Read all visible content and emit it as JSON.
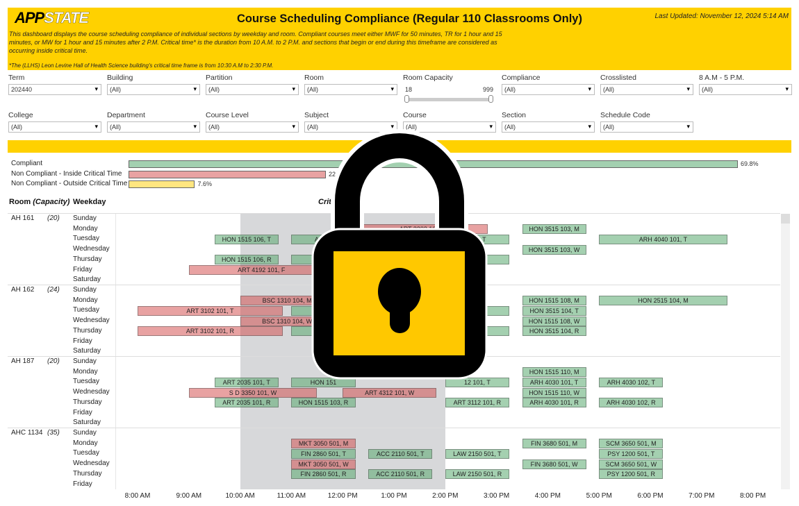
{
  "header": {
    "logo_text": "APPSTATE",
    "title": "Course Scheduling Compliance (Regular 110 Classrooms Only)",
    "last_updated": "Last Updated: November 12, 2024 5:14 AM",
    "description": "This dashboard displays the course scheduling compliance of individual sections by weekday and room. Compliant courses meet either MWF for 50 minutes, TR for 1 hour and 15 minutes, or MW for 1 hour and 15 minutes after 2 P.M. Critical time* is the duration from 10 A.M. to 2 P.M. and sections that begin or end during this timeframe are considered as occurring inside critical time.",
    "note": "*The (LLHS) Leon Levine Hall of Health Science building's critical time frame is from 10:30 A.M to 2:30 P.M."
  },
  "filters": {
    "row1": [
      {
        "label": "Term",
        "value": "202440"
      },
      {
        "label": "Building",
        "value": "(All)"
      },
      {
        "label": "Partition",
        "value": "(All)"
      },
      {
        "label": "Room",
        "value": "(All)"
      },
      {
        "label": "Room Capacity",
        "min": "18",
        "max": "999"
      },
      {
        "label": "Compliance",
        "value": "(All)"
      },
      {
        "label": "Crosslisted",
        "value": "(All)"
      },
      {
        "label": "8 A.M - 5 P.M.",
        "value": "(All)"
      }
    ],
    "row2": [
      {
        "label": "College",
        "value": "(All)"
      },
      {
        "label": "Department",
        "value": "(All)"
      },
      {
        "label": "Course Level",
        "value": "(All)"
      },
      {
        "label": "Subject",
        "value": "(All)"
      },
      {
        "label": "Course",
        "value": "(All)"
      },
      {
        "label": "Section",
        "value": "(All)"
      },
      {
        "label": "Schedule Code",
        "value": "(All)"
      }
    ]
  },
  "summary": [
    {
      "label": "Compliant",
      "percent": 69.8,
      "pct_text": "69.8%",
      "color": "#a3d0b0"
    },
    {
      "label": "Non Compliant - Inside Critical Time",
      "percent": 22.6,
      "pct_text": "22",
      "color": "#e8a2a2"
    },
    {
      "label": "Non Compliant - Outside Critical Time",
      "percent": 7.6,
      "pct_text": "7.6%",
      "color": "#ffe680"
    }
  ],
  "table_header": {
    "room": "Room ",
    "capacity": "(Capacity)",
    "weekday": "Weekday",
    "critical": "Criti",
    "critical_end": "e"
  },
  "days": [
    "Sunday",
    "Monday",
    "Tuesday",
    "Wednesday",
    "Thursday",
    "Friday",
    "Saturday"
  ],
  "time_ticks": [
    "8:00 AM",
    "9:00 AM",
    "10:00 AM",
    "11:00 AM",
    "12:00 PM",
    "1:00 PM",
    "2:00 PM",
    "3:00 PM",
    "4:00 PM",
    "5:00 PM",
    "6:00 PM",
    "7:00 PM",
    "8:00 PM"
  ],
  "critical_time": [
    10,
    14
  ],
  "colors": {
    "compliant": "#a3d0b0",
    "non_compliant": "#e8a2a2",
    "brand": "#ffd100"
  },
  "rooms": [
    {
      "name": "AH 161",
      "capacity": "(20)",
      "sections": [
        {
          "label": "ART 3303 101, M",
          "day": 1,
          "start": 12.33,
          "end": 14.83,
          "ok": false
        },
        {
          "label": "HON 1515 106, T",
          "day": 2,
          "start": 9.5,
          "end": 10.75,
          "ok": true
        },
        {
          "label": "ART 2",
          "day": 2,
          "start": 11.0,
          "end": 12.25,
          "ok": true
        },
        {
          "label": "104, T",
          "day": 2,
          "start": 14.0,
          "end": 15.25,
          "ok": true
        },
        {
          "label": "HON 3515 103, M",
          "day": 1,
          "start": 15.5,
          "end": 16.75,
          "ok": true
        },
        {
          "label": "ARH 4040 101, T",
          "day": 2,
          "start": 17.0,
          "end": 19.5,
          "ok": true
        },
        {
          "label": "HON 3515 103, W",
          "day": 3,
          "start": 15.5,
          "end": 16.75,
          "ok": true
        },
        {
          "label": "HON 1515 106, R",
          "day": 4,
          "start": 9.5,
          "end": 10.75,
          "ok": true
        },
        {
          "label": "ART",
          "day": 4,
          "start": 11.0,
          "end": 12.25,
          "ok": true
        },
        {
          "label": "04, R",
          "day": 4,
          "start": 14.0,
          "end": 15.25,
          "ok": true
        },
        {
          "label": "ART 4192 101, F",
          "day": 5,
          "start": 9.0,
          "end": 11.83,
          "ok": false
        }
      ]
    },
    {
      "name": "AH 162",
      "capacity": "(24)",
      "sections": [
        {
          "label": "BSC 1310 104, M",
          "day": 1,
          "start": 10.0,
          "end": 11.83,
          "ok": false
        },
        {
          "label": "HON 1515 108, M",
          "day": 1,
          "start": 15.5,
          "end": 16.75,
          "ok": true
        },
        {
          "label": "HON 2515 104, M",
          "day": 1,
          "start": 17.0,
          "end": 19.5,
          "ok": true
        },
        {
          "label": "ART 3102 101, T",
          "day": 2,
          "start": 8.0,
          "end": 10.83,
          "ok": false
        },
        {
          "label": "HON",
          "day": 2,
          "start": 11.0,
          "end": 12.25,
          "ok": true
        },
        {
          "label": "03, T",
          "day": 2,
          "start": 14.0,
          "end": 15.25,
          "ok": true
        },
        {
          "label": "HON 3515 104, T",
          "day": 2,
          "start": 15.5,
          "end": 16.75,
          "ok": true
        },
        {
          "label": "BSC 1310 104, W",
          "day": 3,
          "start": 10.0,
          "end": 11.83,
          "ok": false
        },
        {
          "label": "HON 1515 108, W",
          "day": 3,
          "start": 15.5,
          "end": 16.75,
          "ok": true
        },
        {
          "label": "ART 3102 101, R",
          "day": 4,
          "start": 8.0,
          "end": 10.83,
          "ok": false
        },
        {
          "label": "HON",
          "day": 4,
          "start": 11.0,
          "end": 12.25,
          "ok": true
        },
        {
          "label": "03, R",
          "day": 4,
          "start": 14.0,
          "end": 15.25,
          "ok": true
        },
        {
          "label": "HON 3515 104, R",
          "day": 4,
          "start": 15.5,
          "end": 16.75,
          "ok": true
        }
      ]
    },
    {
      "name": "AH 187",
      "capacity": "(20)",
      "sections": [
        {
          "label": "HON 1515 110, M",
          "day": 1,
          "start": 15.5,
          "end": 16.75,
          "ok": true
        },
        {
          "label": "ART 2035 101, T",
          "day": 2,
          "start": 9.5,
          "end": 10.75,
          "ok": true
        },
        {
          "label": "HON 151",
          "day": 2,
          "start": 11.0,
          "end": 12.25,
          "ok": true
        },
        {
          "label": "12 101, T",
          "day": 2,
          "start": 14.0,
          "end": 15.25,
          "ok": true
        },
        {
          "label": "ARH 4030 101, T",
          "day": 2,
          "start": 15.5,
          "end": 16.75,
          "ok": true
        },
        {
          "label": "ARH 4030 102, T",
          "day": 2,
          "start": 17.0,
          "end": 18.25,
          "ok": true
        },
        {
          "label": "S D 3350 101, W",
          "day": 3,
          "start": 9.0,
          "end": 11.5,
          "ok": false
        },
        {
          "label": "ART 4312 101, W",
          "day": 3,
          "start": 12.0,
          "end": 13.83,
          "ok": false
        },
        {
          "label": "HON 1515 110, W",
          "day": 3,
          "start": 15.5,
          "end": 16.75,
          "ok": true
        },
        {
          "label": "ART 2035 101, R",
          "day": 4,
          "start": 9.5,
          "end": 10.75,
          "ok": true
        },
        {
          "label": "HON 1515 103, R",
          "day": 4,
          "start": 11.0,
          "end": 12.25,
          "ok": true
        },
        {
          "label": "ART 3112 101, R",
          "day": 4,
          "start": 14.0,
          "end": 15.25,
          "ok": true
        },
        {
          "label": "ARH 4030 101, R",
          "day": 4,
          "start": 15.5,
          "end": 16.75,
          "ok": true
        },
        {
          "label": "ARH 4030 102, R",
          "day": 4,
          "start": 17.0,
          "end": 18.25,
          "ok": true
        }
      ]
    },
    {
      "name": "AHC 1134",
      "capacity": "(35)",
      "sections": [
        {
          "label": "MKT 3050 501, M",
          "day": 1,
          "start": 11.0,
          "end": 12.25,
          "ok": false
        },
        {
          "label": "FIN 3680 501, M",
          "day": 1,
          "start": 15.5,
          "end": 16.75,
          "ok": true
        },
        {
          "label": "SCM 3650 501, M",
          "day": 1,
          "start": 17.0,
          "end": 18.25,
          "ok": true
        },
        {
          "label": "FIN 2860 501, T",
          "day": 2,
          "start": 11.0,
          "end": 12.25,
          "ok": true
        },
        {
          "label": "ACC 2110 501, T",
          "day": 2,
          "start": 12.5,
          "end": 13.75,
          "ok": true
        },
        {
          "label": "LAW 2150 501, T",
          "day": 2,
          "start": 14.0,
          "end": 15.25,
          "ok": true
        },
        {
          "label": "PSY 1200 501, T",
          "day": 2,
          "start": 17.0,
          "end": 18.25,
          "ok": true
        },
        {
          "label": "MKT 3050 501, W",
          "day": 3,
          "start": 11.0,
          "end": 12.25,
          "ok": false
        },
        {
          "label": "FIN 3680 501, W",
          "day": 3,
          "start": 15.5,
          "end": 16.75,
          "ok": true
        },
        {
          "label": "SCM 3650 501, W",
          "day": 3,
          "start": 17.0,
          "end": 18.25,
          "ok": true
        },
        {
          "label": "FIN 2860 501, R",
          "day": 4,
          "start": 11.0,
          "end": 12.25,
          "ok": true
        },
        {
          "label": "ACC 2110 501, R",
          "day": 4,
          "start": 12.5,
          "end": 13.75,
          "ok": true
        },
        {
          "label": "LAW 2150 501, R",
          "day": 4,
          "start": 14.0,
          "end": 15.25,
          "ok": true
        },
        {
          "label": "PSY 1200 501, R",
          "day": 4,
          "start": 17.0,
          "end": 18.25,
          "ok": true
        }
      ]
    }
  ],
  "overlay": {
    "icon": "padlock-icon",
    "color": "#ffc800"
  }
}
